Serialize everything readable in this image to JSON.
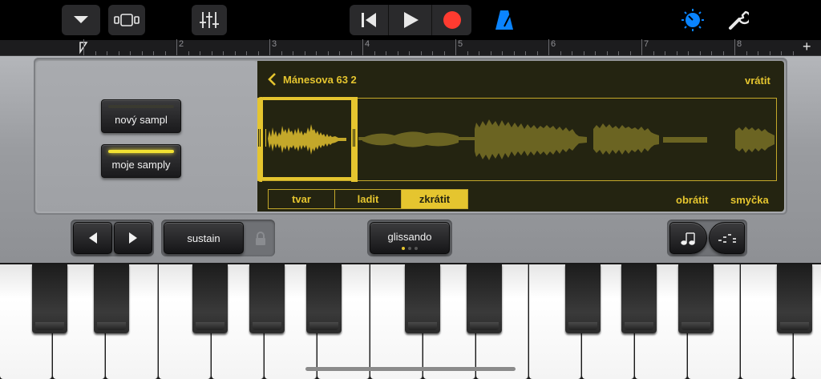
{
  "colors": {
    "accent_yellow": "#e5c52f",
    "record_red": "#ff3b30",
    "blue": "#0a84ff",
    "display_bg": "#242411"
  },
  "toolbar": {
    "icons": [
      "dropdown-icon",
      "tracks-view-icon",
      "mixer-icon",
      "rewind-icon",
      "play-icon",
      "record-icon",
      "metronome-icon",
      "master-knob-icon",
      "settings-wrench-icon"
    ]
  },
  "ruler": {
    "labels": [
      "2",
      "3",
      "4",
      "5",
      "6",
      "7",
      "8"
    ],
    "add_symbol": "+"
  },
  "sampler": {
    "new_sample_label": "nový sampl",
    "my_samples_label": "moje samply",
    "sample_name": "Mánesova 63 2",
    "undo_label": "vrátit",
    "tabs": [
      {
        "label": "tvar",
        "active": false
      },
      {
        "label": "ladit",
        "active": false
      },
      {
        "label": "zkrátit",
        "active": true
      }
    ],
    "reverse_label": "obrátit",
    "loop_label": "smyčka"
  },
  "controls": {
    "sustain_label": "sustain",
    "glissando_label": "glissando",
    "glissando_pages": 3,
    "glissando_active_page": 1
  }
}
